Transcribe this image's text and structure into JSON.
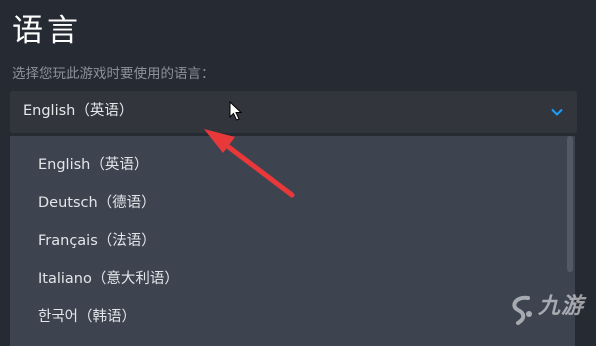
{
  "page": {
    "title": "语言",
    "subtitle": "选择您玩此游戏时要使用的语言："
  },
  "language_select": {
    "selected": "English（英语）",
    "icon": "chevron-down-icon",
    "accent_color": "#1a9fff"
  },
  "dropdown": {
    "options": [
      "English（英语）",
      "Deutsch（德语）",
      "Français（法语）",
      "Italiano（意大利语）",
      "한국어（韩语）"
    ]
  },
  "annotation": {
    "arrow_color": "#e8383a"
  },
  "watermark": {
    "text": "九游",
    "icon": "jiuyou-logo-icon"
  }
}
